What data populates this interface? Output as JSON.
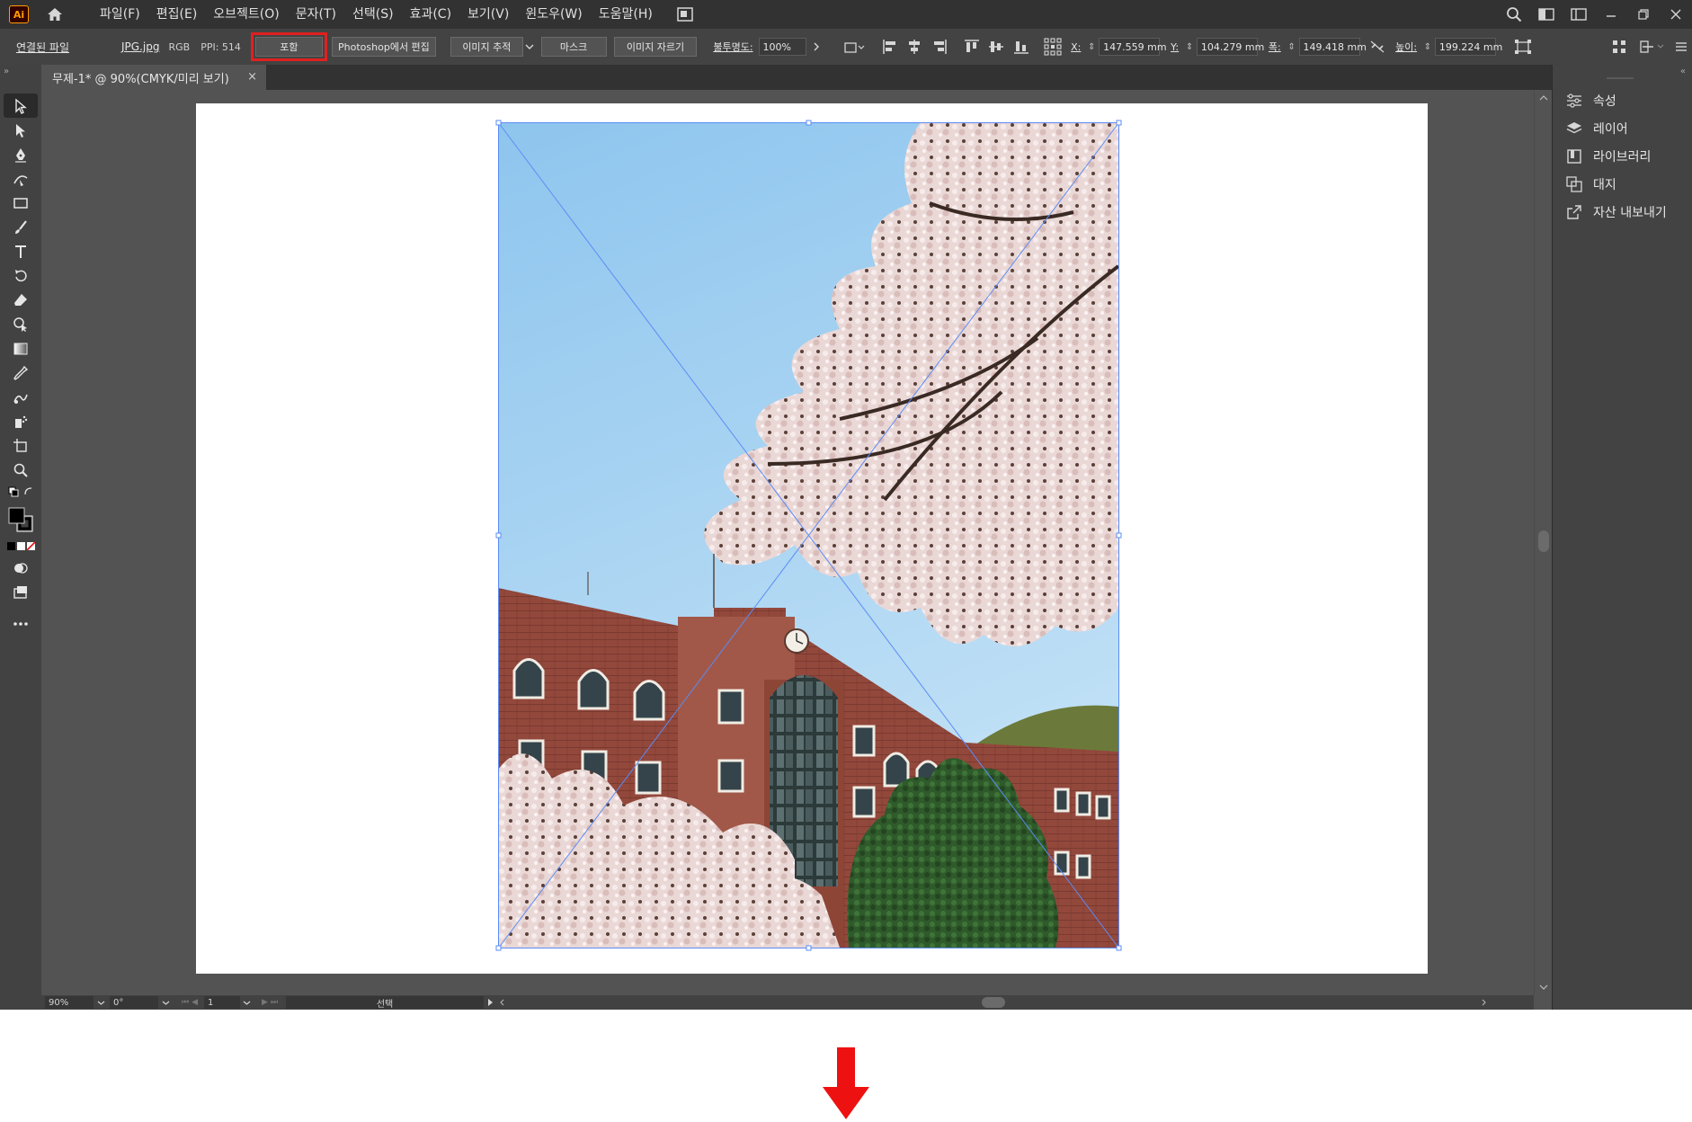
{
  "app": {
    "logo_text": "Ai",
    "menu": [
      "파일(F)",
      "편집(E)",
      "오브젝트(O)",
      "문자(T)",
      "선택(S)",
      "효과(C)",
      "보기(V)",
      "윈도우(W)",
      "도움말(H)"
    ]
  },
  "control_bar": {
    "linked_file_label": "연결된 파일",
    "file_name": "JPG.jpg",
    "color_mode": "RGB",
    "ppi_label": "PPI: 514",
    "embed_button": "포함",
    "edit_in_photoshop_button": "Photoshop에서 편집",
    "image_trace_button": "이미지 추적",
    "mask_button": "마스크",
    "crop_image_button": "이미지 자르기",
    "opacity_label": "불투명도:",
    "opacity_value": "100%",
    "x_label": "X:",
    "x_value": "147.559 mm",
    "y_label": "Y:",
    "y_value": "104.279 mm",
    "width_label": "폭:",
    "width_value": "149.418 mm",
    "height_label": "높이:",
    "height_value": "199.224 mm"
  },
  "document_tab": {
    "title": "무제-1* @ 90%(CMYK/미리 보기)",
    "close": "×"
  },
  "right_panel": {
    "items": [
      "속성",
      "레이어",
      "라이브러리",
      "대지",
      "자산 내보내기"
    ]
  },
  "status_bar": {
    "zoom": "90%",
    "rotation": "0°",
    "artboard_number": "1",
    "tool_name": "선택"
  },
  "colors": {
    "highlight_outline": "#e02020",
    "selection_blue": "#5b8cf5",
    "down_arrow": "#ee1111"
  }
}
